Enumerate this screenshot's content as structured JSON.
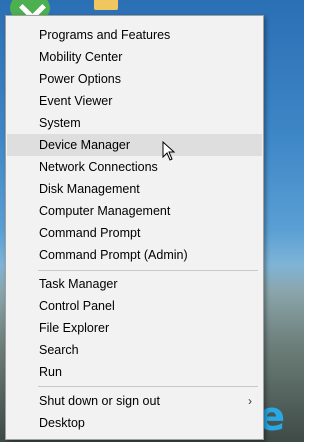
{
  "menu": {
    "items": [
      {
        "label": "Programs and Features"
      },
      {
        "label": "Mobility Center"
      },
      {
        "label": "Power Options"
      },
      {
        "label": "Event Viewer"
      },
      {
        "label": "System"
      },
      {
        "label": "Device Manager"
      },
      {
        "label": "Network Connections"
      },
      {
        "label": "Disk Management"
      },
      {
        "label": "Computer Management"
      },
      {
        "label": "Command Prompt"
      },
      {
        "label": "Command Prompt (Admin)"
      },
      {
        "label": "Task Manager"
      },
      {
        "label": "Control Panel"
      },
      {
        "label": "File Explorer"
      },
      {
        "label": "Search"
      },
      {
        "label": "Run"
      },
      {
        "label": "Shut down or sign out"
      },
      {
        "label": "Desktop"
      }
    ],
    "hovered_item": "Device Manager",
    "submenu_arrow": "›"
  },
  "desktop": {
    "logo_glyph": "e"
  },
  "colors": {
    "menu_background": "#f2f2f2",
    "hover_background": "#dedede",
    "edge_logo": "#29a8e6"
  },
  "icons": {
    "cursor": "mouse-pointer-icon",
    "submenu": "chevron-right-icon"
  }
}
